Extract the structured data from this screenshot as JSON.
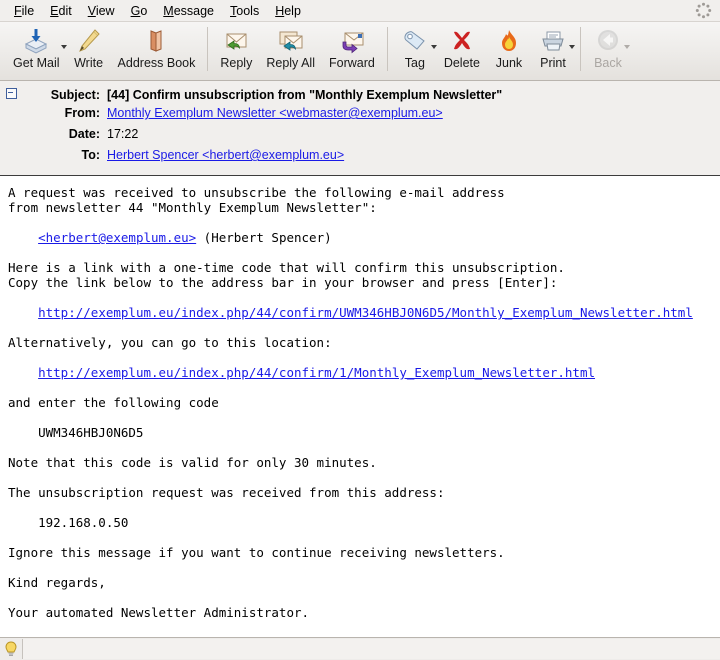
{
  "menubar": {
    "items": [
      {
        "mnemonic": "F",
        "rest": "ile",
        "name": "menu-file"
      },
      {
        "mnemonic": "E",
        "rest": "dit",
        "name": "menu-edit"
      },
      {
        "mnemonic": "V",
        "rest": "iew",
        "name": "menu-view"
      },
      {
        "mnemonic": "G",
        "rest": "o",
        "name": "menu-go"
      },
      {
        "mnemonic": "M",
        "rest": "essage",
        "name": "menu-message"
      },
      {
        "mnemonic": "T",
        "rest": "ools",
        "name": "menu-tools"
      },
      {
        "mnemonic": "H",
        "rest": "elp",
        "name": "menu-help"
      }
    ],
    "throbber_icon": "activity-throbber-icon"
  },
  "toolbar": {
    "buttons": [
      {
        "label": "Get Mail",
        "icon": "get-mail-icon",
        "dropdown": true,
        "disabled": false
      },
      {
        "label": "Write",
        "icon": "write-pencil-icon",
        "dropdown": false,
        "disabled": false
      },
      {
        "label": "Address Book",
        "icon": "address-book-icon",
        "dropdown": false,
        "disabled": false
      },
      {
        "label": "Reply",
        "icon": "reply-icon",
        "dropdown": false,
        "disabled": false
      },
      {
        "label": "Reply All",
        "icon": "reply-all-icon",
        "dropdown": false,
        "disabled": false
      },
      {
        "label": "Forward",
        "icon": "forward-icon",
        "dropdown": false,
        "disabled": false
      },
      {
        "label": "Tag",
        "icon": "tag-icon",
        "dropdown": true,
        "disabled": false
      },
      {
        "label": "Delete",
        "icon": "delete-x-icon",
        "dropdown": false,
        "disabled": false
      },
      {
        "label": "Junk",
        "icon": "junk-flame-icon",
        "dropdown": false,
        "disabled": false
      },
      {
        "label": "Print",
        "icon": "printer-icon",
        "dropdown": true,
        "disabled": false
      },
      {
        "label": "Back",
        "icon": "back-arrow-icon",
        "dropdown": true,
        "disabled": true
      }
    ]
  },
  "message_header": {
    "subject_label": "Subject:",
    "subject_value": "[44] Confirm unsubscription from \"Monthly Exemplum Newsletter\"",
    "from_label": "From:",
    "from_value": "Monthly Exemplum Newsletter <webmaster@exemplum.eu>",
    "date_label": "Date:",
    "date_value": "17:22",
    "to_label": "To:",
    "to_value": "Herbert Spencer <herbert@exemplum.eu>"
  },
  "body": {
    "lines": [
      {
        "text": "A request was received to unsubscribe the following e-mail address"
      },
      {
        "text": "from newsletter 44 \"Monthly Exemplum Newsletter\":"
      },
      {
        "text": ""
      },
      {
        "text": "    ",
        "link": "<herbert@exemplum.eu>",
        "after": " (Herbert Spencer)"
      },
      {
        "text": ""
      },
      {
        "text": "Here is a link with a one-time code that will confirm this unsubscription."
      },
      {
        "text": "Copy the link below to the address bar in your browser and press [Enter]:"
      },
      {
        "text": ""
      },
      {
        "text": "    ",
        "link": "http://exemplum.eu/index.php/44/confirm/UWM346HBJ0N6D5/Monthly_Exemplum_Newsletter.html",
        "after": ""
      },
      {
        "text": ""
      },
      {
        "text": "Alternatively, you can go to this location:"
      },
      {
        "text": ""
      },
      {
        "text": "    ",
        "link": "http://exemplum.eu/index.php/44/confirm/1/Monthly_Exemplum_Newsletter.html",
        "after": ""
      },
      {
        "text": ""
      },
      {
        "text": "and enter the following code"
      },
      {
        "text": ""
      },
      {
        "text": "    UWM346HBJ0N6D5"
      },
      {
        "text": ""
      },
      {
        "text": "Note that this code is valid for only 30 minutes."
      },
      {
        "text": ""
      },
      {
        "text": "The unsubscription request was received from this address:"
      },
      {
        "text": ""
      },
      {
        "text": "    192.168.0.50"
      },
      {
        "text": ""
      },
      {
        "text": "Ignore this message if you want to continue receiving newsletters."
      },
      {
        "text": ""
      },
      {
        "text": "Kind regards,"
      },
      {
        "text": ""
      },
      {
        "text": "Your automated Newsletter Administrator."
      }
    ]
  },
  "statusbar": {
    "icon": "lightbulb-icon",
    "text": ""
  },
  "colors": {
    "link": "#1a1ae6",
    "chrome": "#f1efed",
    "toolbar_border": "#b9b4ae"
  }
}
